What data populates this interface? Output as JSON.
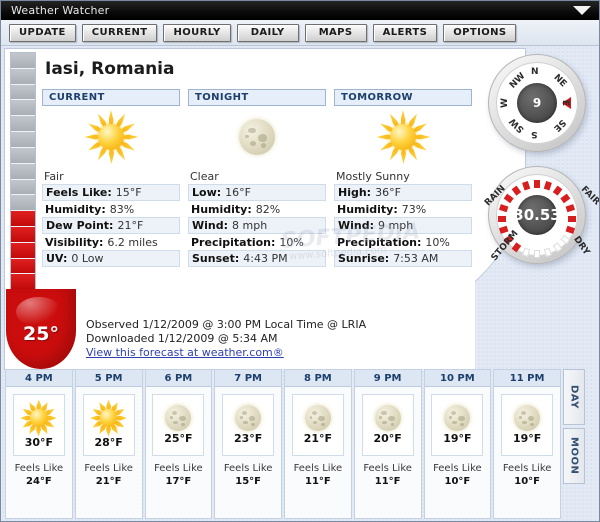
{
  "window": {
    "title": "Weather Watcher",
    "caret_icon": "chevron-down-icon"
  },
  "toolbar": {
    "buttons": [
      {
        "label": "UPDATE"
      },
      {
        "label": "CURRENT"
      },
      {
        "label": "HOURLY"
      },
      {
        "label": "DAILY"
      },
      {
        "label": "MAPS"
      },
      {
        "label": "ALERTS"
      },
      {
        "label": "OPTIONS"
      }
    ]
  },
  "location": "Iasi, Romania",
  "current_temp": "25°",
  "columns": [
    {
      "header": "CURRENT",
      "icon": "sun-icon",
      "condition": "Fair",
      "rows": [
        {
          "label": "Feels Like:",
          "value": "15°F",
          "alt": true
        },
        {
          "label": "Humidity:",
          "value": "83%",
          "alt": false
        },
        {
          "label": "Dew Point:",
          "value": "21°F",
          "alt": true
        },
        {
          "label": "Visibility:",
          "value": "6.2 miles",
          "alt": false
        },
        {
          "label": "UV:",
          "value": "0 Low",
          "alt": true
        }
      ]
    },
    {
      "header": "TONIGHT",
      "icon": "moon-icon",
      "condition": "Clear",
      "rows": [
        {
          "label": "Low:",
          "value": "16°F",
          "alt": true
        },
        {
          "label": "Humidity:",
          "value": "82%",
          "alt": false
        },
        {
          "label": "Wind:",
          "value": "8 mph",
          "alt": true
        },
        {
          "label": "Precipitation:",
          "value": "10%",
          "alt": false
        },
        {
          "label": "Sunset:",
          "value": "4:43 PM",
          "alt": true
        }
      ]
    },
    {
      "header": "TOMORROW",
      "icon": "sun-icon",
      "condition": "Mostly Sunny",
      "rows": [
        {
          "label": "High:",
          "value": "36°F",
          "alt": true
        },
        {
          "label": "Humidity:",
          "value": "73%",
          "alt": false
        },
        {
          "label": "Wind:",
          "value": "9 mph",
          "alt": true
        },
        {
          "label": "Precipitation:",
          "value": "10%",
          "alt": false
        },
        {
          "label": "Sunrise:",
          "value": "7:53 AM",
          "alt": true
        }
      ]
    }
  ],
  "compass": {
    "name": "wind-compass",
    "value": "9",
    "pointing": "E",
    "directions": [
      "N",
      "NE",
      "E",
      "SE",
      "S",
      "SW",
      "W",
      "NW"
    ]
  },
  "barometer": {
    "name": "barometer-gauge",
    "value": "30.53",
    "labels": [
      "RAIN",
      "FAIR",
      "DRY",
      "STORM"
    ]
  },
  "observed": {
    "line1": "Observed 1/12/2009 @ 3:00 PM Local Time @ LRIA",
    "line2": "Downloaded 1/12/2009 @ 5:34 AM",
    "link": "View this forecast at weather.com®"
  },
  "hourly": [
    {
      "hour": "4 PM",
      "icon": "sun-icon",
      "temp": "30°F",
      "feels_label": "Feels Like",
      "feels": "24°F"
    },
    {
      "hour": "5 PM",
      "icon": "sun-icon",
      "temp": "28°F",
      "feels_label": "Feels Like",
      "feels": "21°F"
    },
    {
      "hour": "6 PM",
      "icon": "moon-icon",
      "temp": "25°F",
      "feels_label": "Feels Like",
      "feels": "17°F"
    },
    {
      "hour": "7 PM",
      "icon": "moon-icon",
      "temp": "23°F",
      "feels_label": "Feels Like",
      "feels": "15°F"
    },
    {
      "hour": "8 PM",
      "icon": "moon-icon",
      "temp": "21°F",
      "feels_label": "Feels Like",
      "feels": "11°F"
    },
    {
      "hour": "9 PM",
      "icon": "moon-icon",
      "temp": "20°F",
      "feels_label": "Feels Like",
      "feels": "11°F"
    },
    {
      "hour": "10 PM",
      "icon": "moon-icon",
      "temp": "19°F",
      "feels_label": "Feels Like",
      "feels": "10°F"
    },
    {
      "hour": "11 PM",
      "icon": "moon-icon",
      "temp": "19°F",
      "feels_label": "Feels Like",
      "feels": "10°F"
    }
  ],
  "side_tabs": [
    {
      "label": "DAY"
    },
    {
      "label": "MOON"
    }
  ],
  "watermark": {
    "line1": "SOFTPEDIA",
    "line2": "www.softpedia.com"
  },
  "colors": {
    "accent_red": "#cc0d0d",
    "header_blue": "#1d3f6b",
    "link": "#2f3fb0"
  }
}
